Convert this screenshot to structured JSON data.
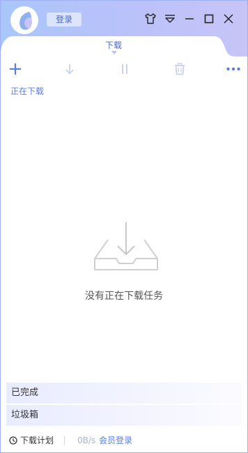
{
  "header": {
    "login_label": "登录",
    "controls": [
      "skin-icon",
      "menu-icon",
      "minimize-icon",
      "maximize-icon",
      "close-icon"
    ]
  },
  "tab": {
    "label": "下载"
  },
  "toolbar": {
    "icons": [
      "add-icon",
      "download-icon",
      "pause-icon",
      "delete-icon",
      "more-icon"
    ],
    "accent": "#5b7ee0",
    "disabled": "#c9d2f0"
  },
  "downloading": {
    "title": "正在下载",
    "empty_text": "没有正在下载任务"
  },
  "sections": {
    "completed": "已完成",
    "trash": "垃圾箱"
  },
  "footer": {
    "plan_label": "下载计划",
    "speed": "0B/s",
    "member_login": "会员登录"
  }
}
